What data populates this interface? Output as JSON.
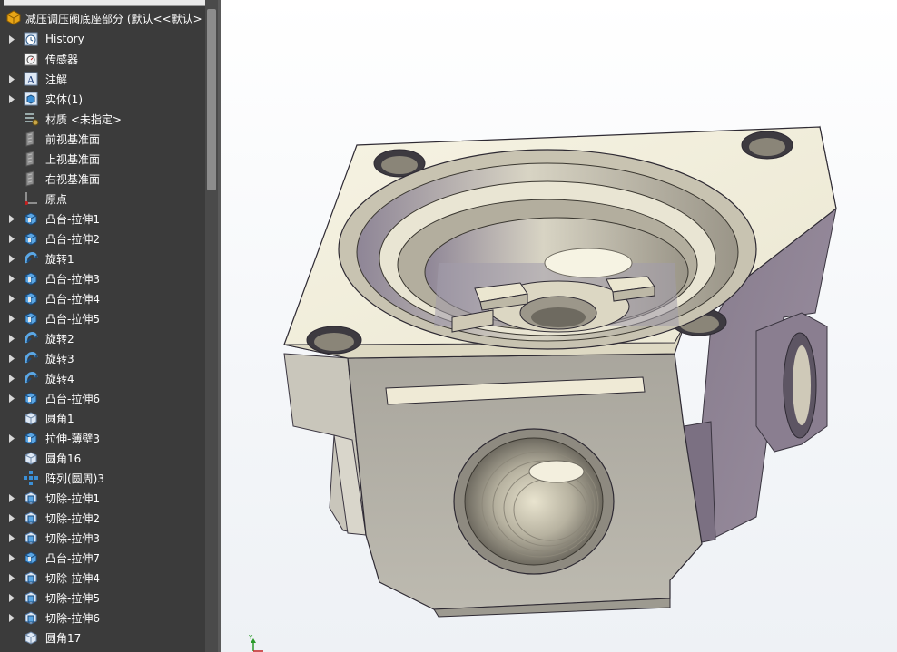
{
  "tree": {
    "root_label": "减压调压阀底座部分 (默认<<默认>",
    "items": [
      {
        "label": "History",
        "icon": "history-icon",
        "expandable": true
      },
      {
        "label": "传感器",
        "icon": "sensor-icon",
        "expandable": false
      },
      {
        "label": "注解",
        "icon": "annotation-icon",
        "expandable": true
      },
      {
        "label": "实体(1)",
        "icon": "solid-bodies-icon",
        "expandable": true
      },
      {
        "label": "材质 <未指定>",
        "icon": "material-icon",
        "expandable": false
      },
      {
        "label": "前视基准面",
        "icon": "plane-icon",
        "expandable": false
      },
      {
        "label": "上视基准面",
        "icon": "plane-icon",
        "expandable": false
      },
      {
        "label": "右视基准面",
        "icon": "plane-icon",
        "expandable": false
      },
      {
        "label": "原点",
        "icon": "origin-icon",
        "expandable": false
      },
      {
        "label": "凸台-拉伸1",
        "icon": "boss-extrude-icon",
        "expandable": true
      },
      {
        "label": "凸台-拉伸2",
        "icon": "boss-extrude-icon",
        "expandable": true
      },
      {
        "label": "旋转1",
        "icon": "revolve-icon",
        "expandable": true
      },
      {
        "label": "凸台-拉伸3",
        "icon": "boss-extrude-icon",
        "expandable": true
      },
      {
        "label": "凸台-拉伸4",
        "icon": "boss-extrude-icon",
        "expandable": true
      },
      {
        "label": "凸台-拉伸5",
        "icon": "boss-extrude-icon",
        "expandable": true
      },
      {
        "label": "旋转2",
        "icon": "revolve-icon",
        "expandable": true
      },
      {
        "label": "旋转3",
        "icon": "revolve-icon",
        "expandable": true
      },
      {
        "label": "旋转4",
        "icon": "revolve-icon",
        "expandable": true
      },
      {
        "label": "凸台-拉伸6",
        "icon": "boss-extrude-icon",
        "expandable": true
      },
      {
        "label": "圆角1",
        "icon": "fillet-icon",
        "expandable": false
      },
      {
        "label": "拉伸-薄壁3",
        "icon": "boss-extrude-icon",
        "expandable": true
      },
      {
        "label": "圆角16",
        "icon": "fillet-icon",
        "expandable": false
      },
      {
        "label": "阵列(圆周)3",
        "icon": "circular-pattern-icon",
        "expandable": false
      },
      {
        "label": "切除-拉伸1",
        "icon": "cut-extrude-icon",
        "expandable": true
      },
      {
        "label": "切除-拉伸2",
        "icon": "cut-extrude-icon",
        "expandable": true
      },
      {
        "label": "切除-拉伸3",
        "icon": "cut-extrude-icon",
        "expandable": true
      },
      {
        "label": "凸台-拉伸7",
        "icon": "boss-extrude-icon",
        "expandable": true
      },
      {
        "label": "切除-拉伸4",
        "icon": "cut-extrude-icon",
        "expandable": true
      },
      {
        "label": "切除-拉伸5",
        "icon": "cut-extrude-icon",
        "expandable": true
      },
      {
        "label": "切除-拉伸6",
        "icon": "cut-extrude-icon",
        "expandable": true
      },
      {
        "label": "圆角17",
        "icon": "fillet-icon",
        "expandable": false
      }
    ]
  },
  "viewport": {
    "triad_label": "Y"
  },
  "colors": {
    "tree_background": "#3b3b3b",
    "part_face_light": "#f2efdf",
    "part_face_gray": "#b9b6ab",
    "part_face_purple": "#8f8394"
  }
}
